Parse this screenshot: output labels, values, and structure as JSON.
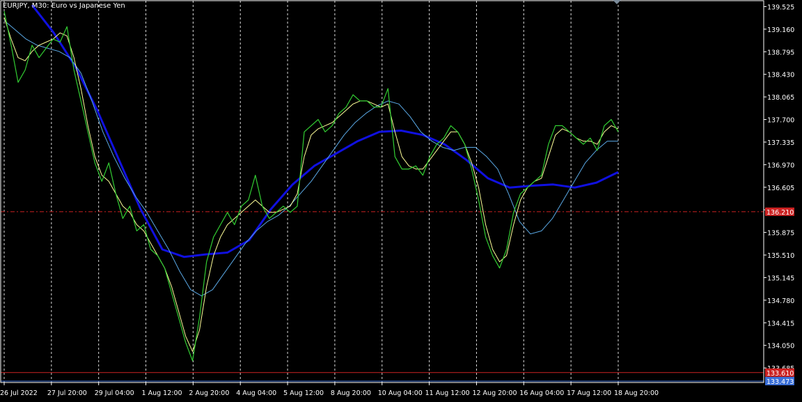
{
  "header": {
    "symbol_title": "EURJPY, M30:  Euro vs Japanese Yen"
  },
  "colors": {
    "background": "#000000",
    "price_line": "#32cd32",
    "fast_ma": "#ffff99",
    "mid_ma": "#5aa9e6",
    "slow_ma": "#1010e0",
    "grid": "#ffffff",
    "axis_text": "#ffffff",
    "dash_level": "#cc2222",
    "level_red": "#cc2222",
    "level_blue": "#3a6fd8"
  },
  "chart_data": {
    "type": "line",
    "y_ticks": [
      "139.525",
      "139.160",
      "138.795",
      "138.430",
      "138.065",
      "137.700",
      "137.335",
      "136.970",
      "136.605",
      "136.240",
      "135.875",
      "135.510",
      "135.145",
      "134.780",
      "134.415",
      "134.050",
      "133.685"
    ],
    "x_ticks": [
      "26 Jul 2022",
      "27 Jul 20:00",
      "29 Jul 04:00",
      "1 Aug 12:00",
      "2 Aug 20:00",
      "4 Aug 04:00",
      "5 Aug 12:00",
      "8 Aug 20:00",
      "10 Aug 04:00",
      "11 Aug 12:00",
      "12 Aug 20:00",
      "16 Aug 04:00",
      "17 Aug 12:00",
      "18 Aug 20:00"
    ],
    "ylim": [
      133.45,
      139.62
    ],
    "grid": "vertical dashed",
    "price_labels": {
      "dash_level": "136.210",
      "red_level": "133.610",
      "blue_level": "133.473"
    },
    "levels": {
      "dash": 136.21,
      "red": 133.61,
      "blue": 133.473
    },
    "series": [
      {
        "key": "price",
        "values": [
          139.45,
          138.9,
          138.3,
          138.5,
          138.9,
          138.7,
          138.85,
          139.0,
          138.95,
          139.2,
          138.5,
          138.0,
          137.5,
          137.0,
          136.7,
          137.0,
          136.5,
          136.1,
          136.3,
          135.9,
          136.0,
          135.6,
          135.5,
          135.3,
          134.9,
          134.5,
          134.1,
          133.8,
          134.5,
          135.4,
          135.8,
          136.0,
          136.2,
          136.0,
          136.3,
          136.4,
          136.8,
          136.3,
          136.1,
          136.2,
          136.3,
          136.2,
          136.3,
          137.5,
          137.6,
          137.7,
          137.5,
          137.6,
          137.8,
          137.9,
          138.1,
          138.0,
          138.0,
          137.9,
          137.9,
          138.2,
          137.1,
          136.9,
          136.9,
          136.95,
          136.8,
          137.1,
          137.3,
          137.4,
          137.6,
          137.5,
          137.3,
          136.9,
          136.4,
          135.8,
          135.5,
          135.3,
          135.6,
          136.2,
          136.5,
          136.6,
          136.7,
          136.8,
          137.3,
          137.6,
          137.6,
          137.5,
          137.4,
          137.3,
          137.4,
          137.2,
          137.6,
          137.7,
          137.5
        ],
        "x_range": [
          0,
          88
        ]
      },
      {
        "key": "fast",
        "values": [
          139.35,
          139.0,
          138.7,
          138.65,
          138.8,
          138.9,
          138.95,
          139.0,
          139.1,
          139.05,
          138.7,
          138.2,
          137.6,
          137.1,
          136.8,
          136.7,
          136.5,
          136.3,
          136.2,
          136.0,
          135.9,
          135.7,
          135.5,
          135.3,
          135.0,
          134.6,
          134.2,
          133.95,
          134.3,
          135.0,
          135.5,
          135.8,
          136.0,
          136.1,
          136.2,
          136.3,
          136.4,
          136.3,
          136.2,
          136.2,
          136.25,
          136.3,
          136.5,
          137.1,
          137.45,
          137.55,
          137.6,
          137.65,
          137.75,
          137.85,
          137.95,
          138.0,
          138.0,
          137.95,
          137.9,
          137.95,
          137.5,
          137.1,
          136.95,
          136.9,
          136.9,
          137.05,
          137.2,
          137.35,
          137.5,
          137.5,
          137.3,
          137.0,
          136.6,
          136.0,
          135.6,
          135.4,
          135.5,
          136.0,
          136.4,
          136.6,
          136.7,
          136.75,
          137.1,
          137.45,
          137.55,
          137.5,
          137.4,
          137.35,
          137.35,
          137.3,
          137.5,
          137.6,
          137.55
        ],
        "x_range": [
          0,
          88
        ]
      },
      {
        "key": "mid",
        "values": [
          139.3,
          139.15,
          139.0,
          138.9,
          138.85,
          138.8,
          138.7,
          138.45,
          138.0,
          137.5,
          137.1,
          136.75,
          136.45,
          136.2,
          135.9,
          135.6,
          135.25,
          134.95,
          134.85,
          134.95,
          135.2,
          135.45,
          135.7,
          135.9,
          136.05,
          136.15,
          136.3,
          136.5,
          136.7,
          136.95,
          137.2,
          137.45,
          137.65,
          137.8,
          137.92,
          138.0,
          137.95,
          137.75,
          137.5,
          137.35,
          137.25,
          137.2,
          137.25,
          137.25,
          137.1,
          136.9,
          136.5,
          136.05,
          135.85,
          135.9,
          136.1,
          136.4,
          136.7,
          137.0,
          137.2,
          137.35,
          137.35
        ],
        "x_range": [
          0,
          88
        ]
      },
      {
        "key": "slow",
        "values": [
          139.55,
          139.1,
          138.55,
          137.85,
          137.05,
          136.25,
          135.6,
          135.48,
          135.52,
          135.55,
          135.75,
          136.25,
          136.65,
          136.95,
          137.15,
          137.35,
          137.5,
          137.52,
          137.45,
          137.3,
          137.05,
          136.75,
          136.6,
          136.63,
          136.65,
          136.6,
          136.68,
          136.85
        ],
        "x_range": [
          4,
          88
        ]
      }
    ]
  }
}
